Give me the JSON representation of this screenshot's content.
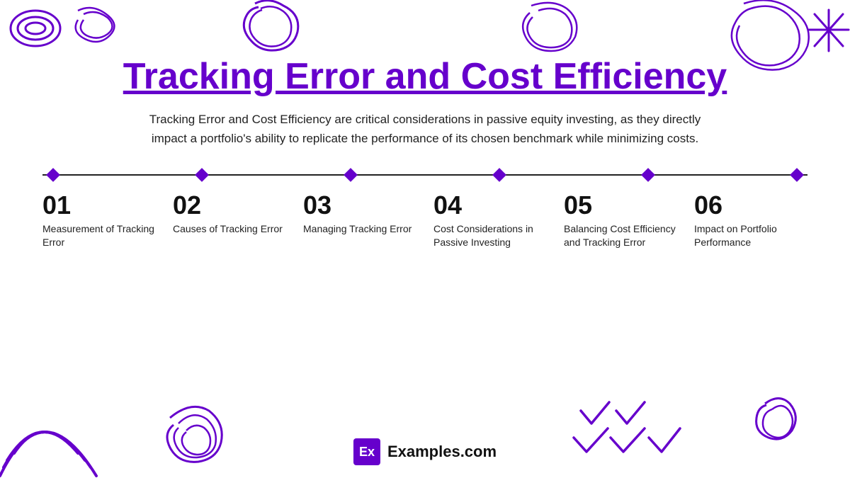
{
  "title": "Tracking Error and Cost Efficiency",
  "subtitle": "Tracking Error and Cost Efficiency are critical considerations in passive equity investing, as they directly impact a portfolio's ability to replicate the performance of its chosen benchmark while minimizing costs.",
  "timeline": {
    "items": [
      {
        "number": "01",
        "label": "Measurement of Tracking Error"
      },
      {
        "number": "02",
        "label": "Causes of Tracking Error"
      },
      {
        "number": "03",
        "label": "Managing Tracking Error"
      },
      {
        "number": "04",
        "label": "Cost Considerations in Passive Investing"
      },
      {
        "number": "05",
        "label": "Balancing Cost Efficiency and Tracking Error"
      },
      {
        "number": "06",
        "label": "Impact on Portfolio Performance"
      }
    ]
  },
  "footer": {
    "badge": "Ex",
    "brand": "Examples.com"
  },
  "colors": {
    "purple": "#6600cc",
    "dark": "#111111"
  }
}
